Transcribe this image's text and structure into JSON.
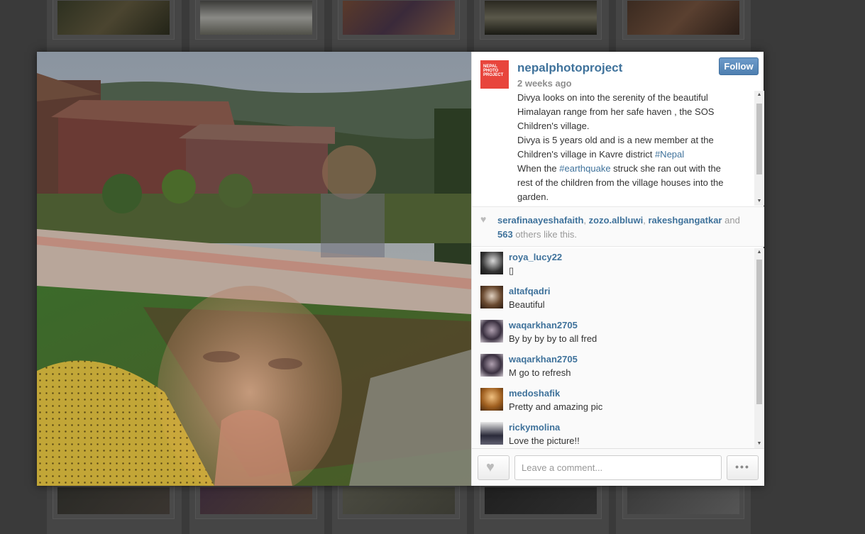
{
  "background_thumbs": {
    "top": [
      "thumb-dark-forest",
      "thumb-smoke",
      "thumb-person-red",
      "thumb-river",
      "thumb-dark"
    ],
    "bottom": [
      "thumb-dark-1",
      "thumb-dark-2",
      "thumb-dark-3",
      "thumb-dark-4",
      "thumb-dark-5"
    ]
  },
  "post": {
    "username": "nepalphotoproject",
    "logo_text": [
      "NEPAL",
      "PHOTO",
      "PROJECT"
    ],
    "timestamp": "2 weeks ago",
    "follow_label": "Follow",
    "caption_lines": [
      "Divya looks on into the serenity of the beautiful",
      "Himalayan range from her safe haven , the SOS",
      "Children's village.",
      "Divya is 5 years old and is a new member at the",
      "Children's village in Kavre district ",
      "When the ",
      "rest of the children from the village houses into the",
      "garden."
    ],
    "caption_tag_nepal": "#Nepal",
    "caption_tag_earthquake": "#earthquake",
    "caption_line_after_earthquake": " struck she ran out with the"
  },
  "likes": {
    "users": [
      "serafinaayeshafaith",
      "zozo.albluwi",
      "rakeshgangatkar"
    ],
    "and_text": "and",
    "count": "563",
    "suffix": "others like this."
  },
  "comments": [
    {
      "user": "roya_lucy22",
      "text": "▯"
    },
    {
      "user": "altafqadri",
      "text": "Beautiful"
    },
    {
      "user": "waqarkhan2705",
      "text": "By by by by to all fred"
    },
    {
      "user": "waqarkhan2705",
      "text": "M go to refresh"
    },
    {
      "user": "medoshafik",
      "text": "Pretty and amazing pic"
    },
    {
      "user": "rickymolina",
      "text": "Love the picture!!"
    }
  ],
  "footer": {
    "comment_placeholder": "Leave a comment...",
    "more_label": "•••"
  },
  "colors": {
    "link": "#3f729b",
    "follow_button": "#5f8fbf",
    "logo_red": "#e8453c"
  }
}
